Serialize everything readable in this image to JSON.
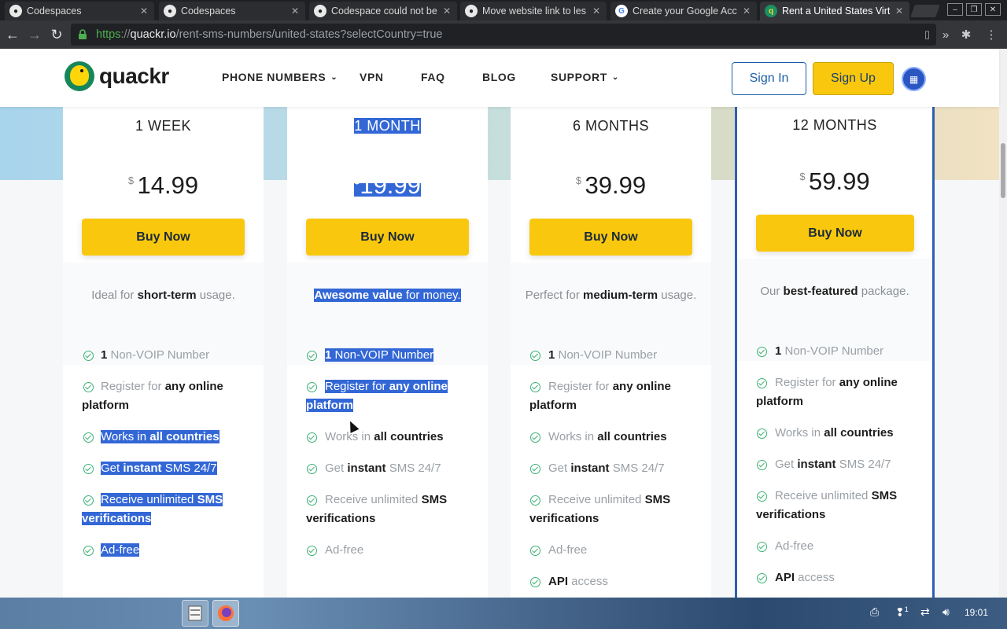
{
  "browser": {
    "tabs": [
      {
        "title": "Codespaces",
        "icon": "github-icon",
        "active": false
      },
      {
        "title": "Codespaces",
        "icon": "github-icon",
        "active": false
      },
      {
        "title": "Codespace could not be",
        "icon": "github-icon",
        "active": false
      },
      {
        "title": "Move website link to les",
        "icon": "github-icon",
        "active": false
      },
      {
        "title": "Create your Google Acc",
        "icon": "google-icon",
        "active": false
      },
      {
        "title": "Rent a United States Virt",
        "icon": "quackr-icon",
        "active": true
      }
    ],
    "url": {
      "scheme": "https",
      "separator": "://",
      "host": "quackr.io",
      "path": "/rent-sms-numbers/united-states?selectCountry=true"
    }
  },
  "site": {
    "logo_text": "quackr",
    "nav": {
      "phone_numbers": "PHONE NUMBERS",
      "vpn": "VPN",
      "faq": "FAQ",
      "blog": "BLOG",
      "support": "SUPPORT"
    },
    "sign_in": "Sign In",
    "sign_up": "Sign Up"
  },
  "plans": [
    {
      "duration": "1 WEEK",
      "currency": "$",
      "price": "14.99",
      "buy_label": "Buy Now",
      "tagline": {
        "pre": "Ideal for ",
        "bold": "short-term",
        "post": " usage."
      },
      "features": [
        {
          "bold_a": "1",
          "text_a": " Non-VOIP Number",
          "bold_b": "",
          "text_b": ""
        },
        {
          "bold_a": "",
          "text_a": "Register for ",
          "bold_b": "any online platform",
          "text_b": ""
        },
        {
          "bold_a": "",
          "text_a": "Works in ",
          "bold_b": "all countries",
          "text_b": ""
        },
        {
          "bold_a": "",
          "text_a": "Get ",
          "bold_b": "instant",
          "text_b": " SMS 24/7"
        },
        {
          "bold_a": "",
          "text_a": "Receive unlimited ",
          "bold_b": "SMS verifications",
          "text_b": ""
        },
        {
          "bold_a": "",
          "text_a": "Ad-free",
          "bold_b": "",
          "text_b": ""
        }
      ]
    },
    {
      "duration": "1 MONTH",
      "currency": "$",
      "price": "19.99",
      "buy_label": "Buy Now",
      "tagline": {
        "pre": "",
        "bold": "Awesome value",
        "post": " for money."
      },
      "features": [
        {
          "bold_a": "1",
          "text_a": " Non-VOIP Number",
          "bold_b": "",
          "text_b": ""
        },
        {
          "bold_a": "",
          "text_a": "Register for ",
          "bold_b": "any online platform",
          "text_b": ""
        },
        {
          "bold_a": "",
          "text_a": "Works in ",
          "bold_b": "all countries",
          "text_b": ""
        },
        {
          "bold_a": "",
          "text_a": "Get ",
          "bold_b": "instant",
          "text_b": " SMS 24/7"
        },
        {
          "bold_a": "",
          "text_a": "Receive unlimited ",
          "bold_b": "SMS verifications",
          "text_b": ""
        },
        {
          "bold_a": "",
          "text_a": "Ad-free",
          "bold_b": "",
          "text_b": ""
        }
      ]
    },
    {
      "duration": "6 MONTHS",
      "currency": "$",
      "price": "39.99",
      "buy_label": "Buy Now",
      "tagline": {
        "pre": "Perfect for ",
        "bold": "medium-term",
        "post": " usage."
      },
      "features": [
        {
          "bold_a": "1",
          "text_a": " Non-VOIP Number",
          "bold_b": "",
          "text_b": ""
        },
        {
          "bold_a": "",
          "text_a": "Register for ",
          "bold_b": "any online platform",
          "text_b": ""
        },
        {
          "bold_a": "",
          "text_a": "Works in ",
          "bold_b": "all countries",
          "text_b": ""
        },
        {
          "bold_a": "",
          "text_a": "Get ",
          "bold_b": "instant",
          "text_b": " SMS 24/7"
        },
        {
          "bold_a": "",
          "text_a": "Receive unlimited ",
          "bold_b": "SMS verifications",
          "text_b": ""
        },
        {
          "bold_a": "",
          "text_a": "Ad-free",
          "bold_b": "",
          "text_b": ""
        },
        {
          "bold_a": "API",
          "text_a": " access",
          "bold_b": "",
          "text_b": ""
        }
      ]
    },
    {
      "duration": "12 MONTHS",
      "currency": "$",
      "price": "59.99",
      "buy_label": "Buy Now",
      "tagline": {
        "pre": "Our ",
        "bold": "best-featured",
        "post": " package."
      },
      "features": [
        {
          "bold_a": "1",
          "text_a": " Non-VOIP Number",
          "bold_b": "",
          "text_b": ""
        },
        {
          "bold_a": "",
          "text_a": "Register for ",
          "bold_b": "any online platform",
          "text_b": ""
        },
        {
          "bold_a": "",
          "text_a": "Works in ",
          "bold_b": "all countries",
          "text_b": ""
        },
        {
          "bold_a": "",
          "text_a": "Get ",
          "bold_b": "instant",
          "text_b": " SMS 24/7"
        },
        {
          "bold_a": "",
          "text_a": "Receive unlimited ",
          "bold_b": "SMS verifications",
          "text_b": ""
        },
        {
          "bold_a": "",
          "text_a": "Ad-free",
          "bold_b": "",
          "text_b": ""
        },
        {
          "bold_a": "API",
          "text_a": " access",
          "bold_b": "",
          "text_b": ""
        }
      ]
    }
  ],
  "taskbar": {
    "clock": "19:01",
    "tray_badge": "1"
  },
  "colors": {
    "accent_yellow": "#f9c80e",
    "brand_green": "#17865a",
    "selection_blue": "#3367d6",
    "check_green": "#3bb273"
  }
}
